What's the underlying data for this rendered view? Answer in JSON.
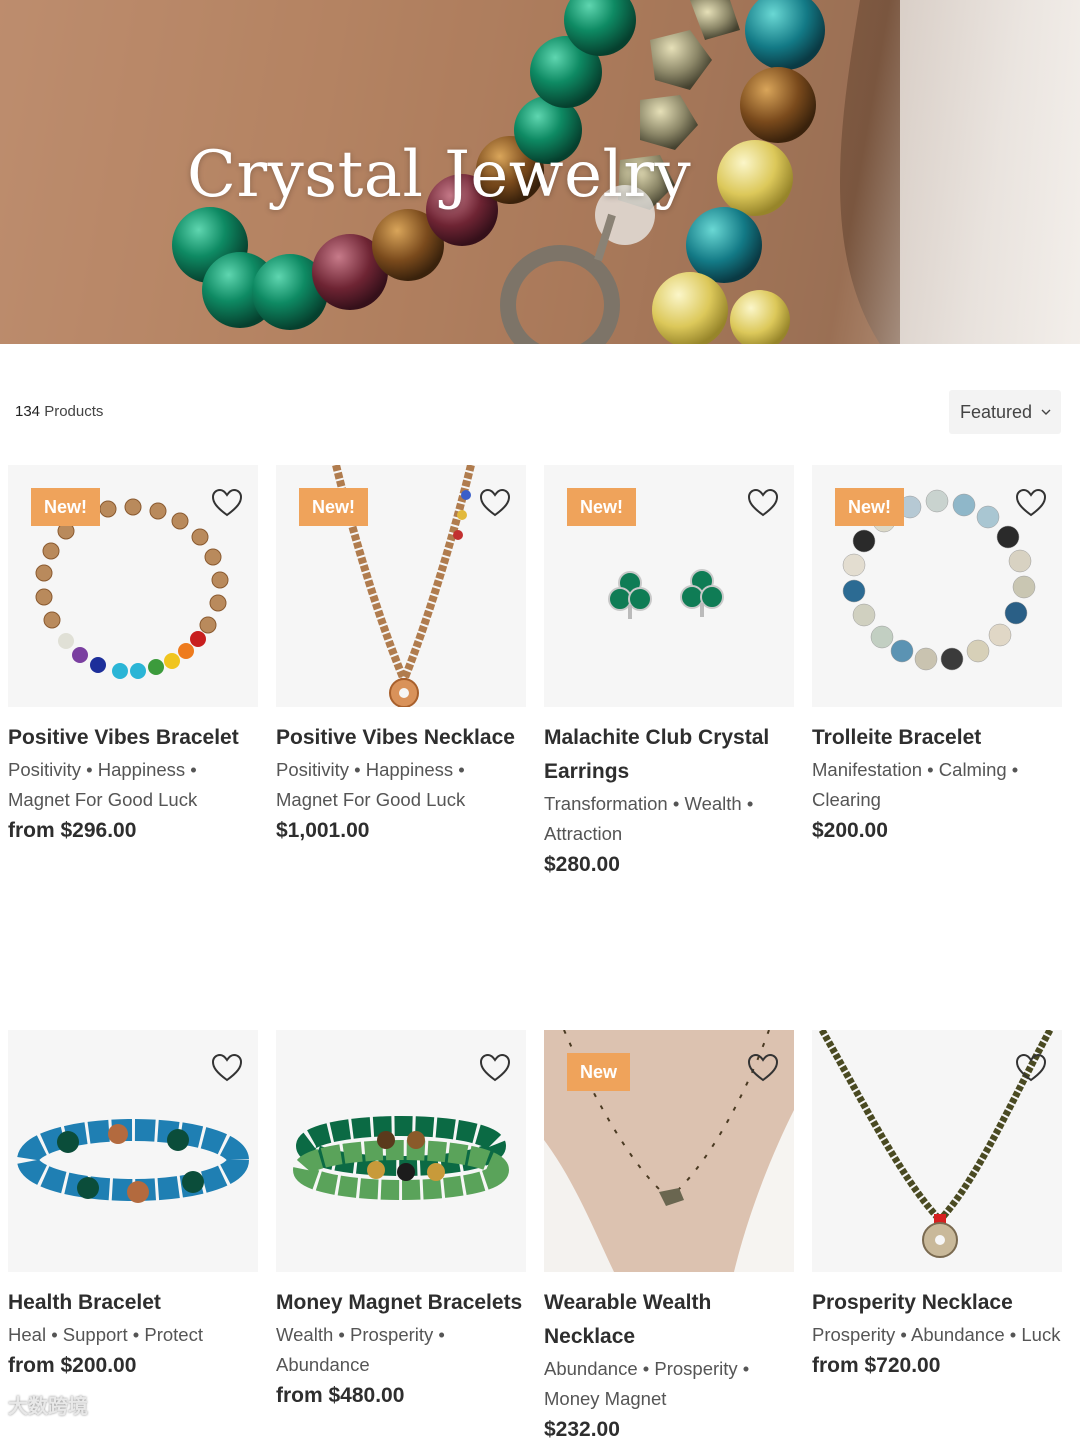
{
  "hero": {
    "title": "Crystal Jewelry"
  },
  "toolbar": {
    "count": "134",
    "count_label": "Products",
    "sort_label": "Featured"
  },
  "products": [
    {
      "badge": "New!",
      "name": "Positive Vibes Bracelet",
      "tags": "Positivity • Happiness • Magnet For Good Luck",
      "price": "from $296.00"
    },
    {
      "badge": "New!",
      "name": "Positive Vibes Necklace",
      "tags": "Positivity • Happiness • Magnet For Good Luck",
      "price": "$1,001.00"
    },
    {
      "badge": "New!",
      "name": "Malachite Club Crystal Earrings",
      "tags": "Transformation • Wealth • Attraction",
      "price": "$280.00"
    },
    {
      "badge": "New!",
      "name": "Trolleite Bracelet",
      "tags": "Manifestation • Calming • Clearing",
      "price": "$200.00"
    },
    {
      "badge": "",
      "name": "Health Bracelet",
      "tags": "Heal • Support • Protect",
      "price": "from $200.00"
    },
    {
      "badge": "",
      "name": "Money Magnet Bracelets",
      "tags": "Wealth • Prosperity • Abundance",
      "price": "from $480.00"
    },
    {
      "badge": "New",
      "name": "Wearable Wealth Necklace",
      "tags": "Abundance • Prosperity • Money Magnet",
      "price": "$232.00"
    },
    {
      "badge": "",
      "name": "Prosperity Necklace",
      "tags": "Prosperity • Abundance • Luck",
      "price": "from $720.00"
    }
  ],
  "watermark": "大数跨境",
  "colors": {
    "badge": "#efa35b",
    "text": "#2e2e2e",
    "muted": "#555555"
  }
}
